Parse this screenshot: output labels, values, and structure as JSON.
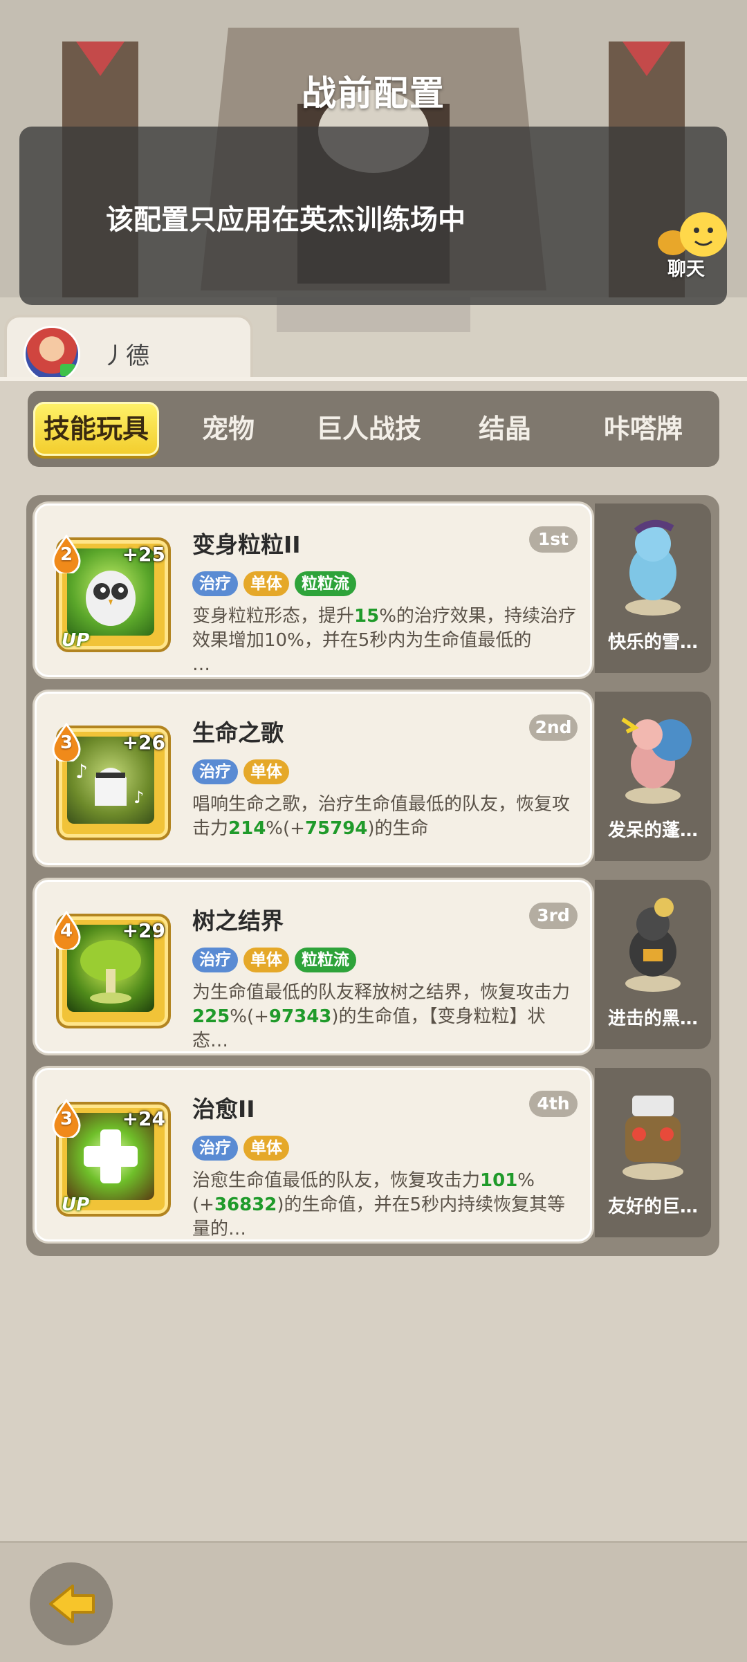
{
  "header": {
    "title": "战前配置",
    "notice": "该配置只应用在英杰训练场中",
    "chat_label": "聊天"
  },
  "player": {
    "name": "丿德"
  },
  "tabs": [
    {
      "label": "技能玩具",
      "active": true
    },
    {
      "label": "宠物",
      "active": false
    },
    {
      "label": "巨人战技",
      "active": false
    },
    {
      "label": "结晶",
      "active": false
    },
    {
      "label": "咔嗒牌",
      "active": false
    }
  ],
  "skills": [
    {
      "level": "2",
      "plus": "+25",
      "up": "UP",
      "name": "变身粒粒II",
      "rank": "1st",
      "tags": [
        "治疗",
        "单体",
        "粒粒流"
      ],
      "desc_parts": [
        "变身粒粒形态，提升",
        "15",
        "%的治疗效果，持续治疗效果增加10%，并在5秒内为生命值最低的",
        "",
        "…"
      ],
      "pet": "快乐的雪…"
    },
    {
      "level": "3",
      "plus": "+26",
      "up": "",
      "name": "生命之歌",
      "rank": "2nd",
      "tags": [
        "治疗",
        "单体"
      ],
      "desc_parts": [
        "唱响生命之歌，治疗生命值最低的队友，恢复攻击力",
        "214",
        "%(+",
        "75794",
        ")的生命"
      ],
      "pet": "发呆的蓬…"
    },
    {
      "level": "4",
      "plus": "+29",
      "up": "",
      "name": "树之结界",
      "rank": "3rd",
      "tags": [
        "治疗",
        "单体",
        "粒粒流"
      ],
      "desc_parts": [
        "为生命值最低的队友释放树之结界，恢复攻击力",
        "225",
        "%(+",
        "97343",
        ")的生命值，【变身粒粒】状态…"
      ],
      "pet": "进击的黑…"
    },
    {
      "level": "3",
      "plus": "+24",
      "up": "UP",
      "name": "治愈II",
      "rank": "4th",
      "tags": [
        "治疗",
        "单体"
      ],
      "desc_parts": [
        "治愈生命值最低的队友，恢复攻击力",
        "101",
        "%(+",
        "36832",
        ")的生命值，并在5秒内持续恢复其等量的…"
      ],
      "pet": "友好的巨…"
    }
  ],
  "colors": {
    "tag_blue": "#5a8bd3",
    "tag_yellow": "#e5a829",
    "tag_green": "#2ea33a",
    "highlight": "#1f9a2a",
    "tab_active": "#f2cc2c"
  },
  "icons": {
    "back": "back-arrow-icon",
    "chat": "chat-emoji-icon"
  }
}
